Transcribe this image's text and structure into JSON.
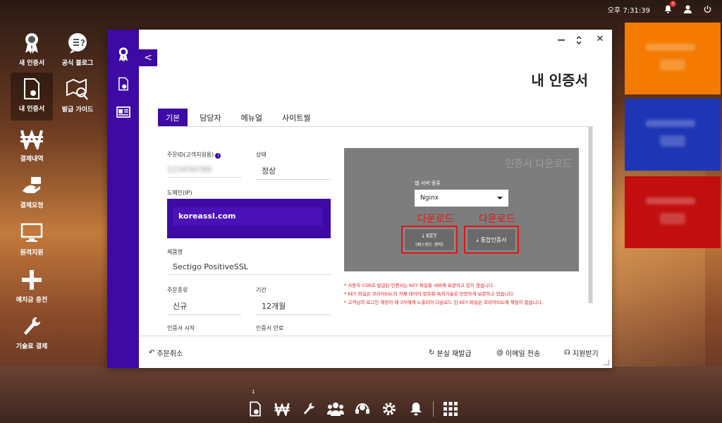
{
  "topbar": {
    "clock": "오후 7:31:39",
    "notification_count": "0"
  },
  "desktop": {
    "items": [
      {
        "label": "새 인증서",
        "icon": "award-icon"
      },
      {
        "label": "공식 블로그",
        "icon": "blog-icon"
      },
      {
        "label": "내 인증서",
        "icon": "certificate-icon"
      },
      {
        "label": "발급 가이드",
        "icon": "guide-map-icon"
      },
      {
        "label": "결제내역",
        "icon": "won-icon"
      },
      {
        "label": "결제요청",
        "icon": "payment-hand-icon"
      },
      {
        "label": "원격지원",
        "icon": "monitor-icon"
      },
      {
        "label": "예치금 충전",
        "icon": "plus-icon"
      },
      {
        "label": "기술료 결제",
        "icon": "wrench-icon"
      }
    ]
  },
  "tiles": {
    "colors": [
      "#f47a00",
      "#1e36b6",
      "#c20e0e"
    ]
  },
  "window": {
    "title": "내 인증서",
    "controls": {
      "back": "<",
      "close": "✕"
    },
    "tabs": [
      "기본",
      "담당자",
      "메뉴얼",
      "사이트씰"
    ],
    "fields": {
      "order_id_label": "주문ID(고객지원용)",
      "order_id_value": "123456789",
      "status_label": "상태",
      "status_value": "정상",
      "domain_label": "도메인(IP)",
      "domain_value": "koreassl.com",
      "product_label": "제품명",
      "product_value": "Sectigo PositiveSSL",
      "order_type_label": "주문종류",
      "order_type_value": "신규",
      "period_label": "기간",
      "period_value": "12개월",
      "cert_start_label": "인증서 시작",
      "cert_end_label": "인증서 만료"
    },
    "download": {
      "title": "인증서 다운로드",
      "server_label": "웹 서버 종류",
      "server_value": "Nginx",
      "annotation_left": "다운로드",
      "annotation_right": "다운로드",
      "key_button": "KEY",
      "key_sub": "(패스워드 생략)",
      "bundle_button": "통합인증서"
    },
    "notes": [
      "* 사용자 CSR로 발급된 인증서는 KEY 파일을 서버에 보관하고 있지 않습니다.",
      "* KEY 파일은 코리아SSL의 자체 데이터 암호화 특허기술로 안전하게 보관하고 있습니다.",
      "* 고객님의 로그인 계정이 제 3자에게 노출되어 다운로드 된 KEY 파일은 코리아SSL에 책임이 없습니다."
    ],
    "footer": {
      "cancel": "주문취소",
      "reissue": "분실 재발급",
      "email": "이메일 전송",
      "support": "지원받기"
    }
  },
  "taskbar": {
    "badge": "1"
  },
  "colors": {
    "accent": "#3d0aa3",
    "annotation": "#e01818"
  }
}
